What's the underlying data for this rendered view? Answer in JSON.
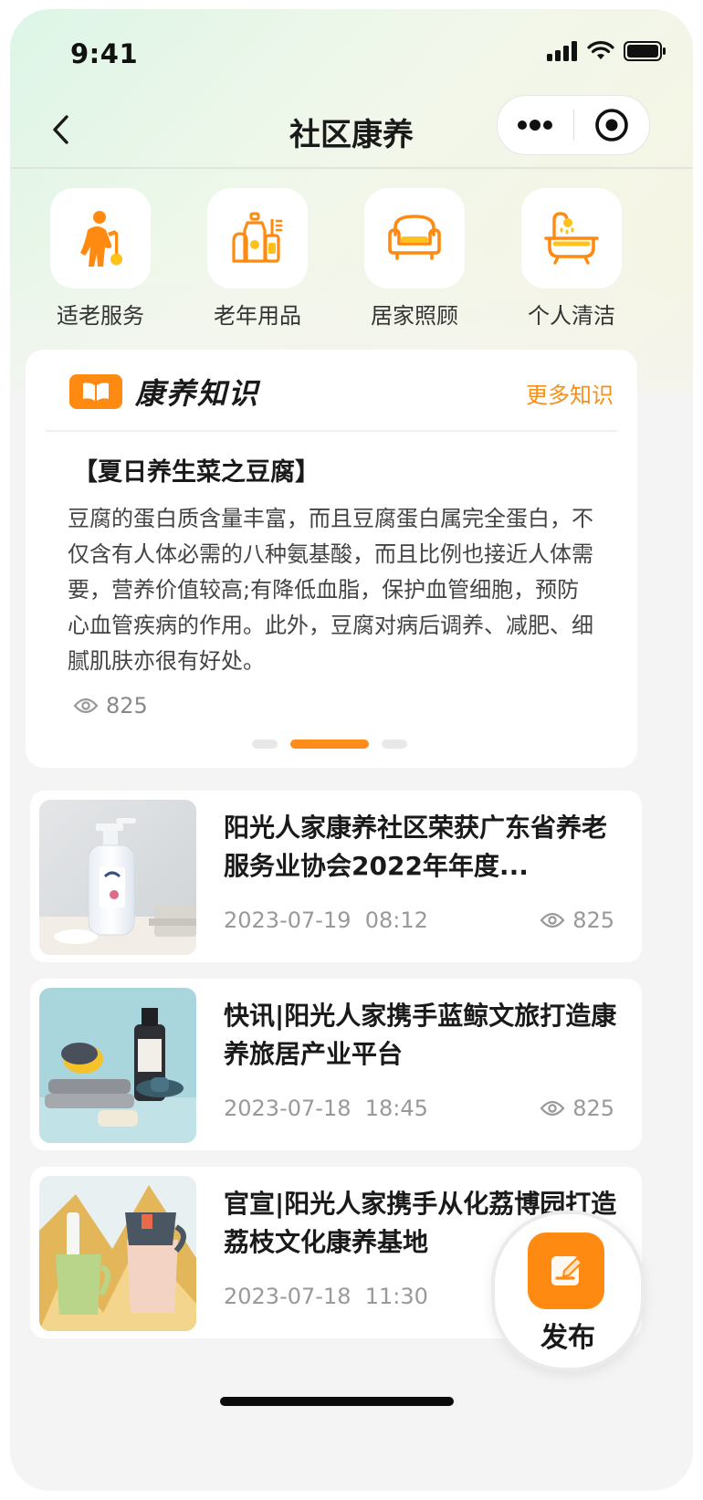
{
  "status_bar": {
    "time": "9:41"
  },
  "nav": {
    "title": "社区康养"
  },
  "categories": [
    {
      "label": "适老服务",
      "icon": "elderly-person-icon"
    },
    {
      "label": "老年用品",
      "icon": "bottles-icon"
    },
    {
      "label": "居家照顾",
      "icon": "sofa-icon"
    },
    {
      "label": "个人清洁",
      "icon": "bathtub-icon"
    }
  ],
  "knowledge": {
    "title": "康养知识",
    "more": "更多知识",
    "article_title": "【夏日养生菜之豆腐】",
    "article_body": "豆腐的蛋白质含量丰富，而且豆腐蛋白属完全蛋白，不仅含有人体必需的八种氨基酸，而且比例也接近人体需要，营养价值较高;有降低血脂，保护血管细胞，预防心血管疾病的作用。此外，豆腐对病后调养、减肥、细腻肌肤亦很有好处。",
    "views": "825",
    "carousel_active_index": 1,
    "carousel_count": 3
  },
  "news": [
    {
      "title": "阳光人家康养社区荣获广东省养老服务业协会2022年年度...",
      "date": "2023-07-19",
      "time": "08:12",
      "views": "825"
    },
    {
      "title": "快讯|阳光人家携手蓝鲸文旅打造康养旅居产业平台",
      "date": "2023-07-18",
      "time": "18:45",
      "views": "825"
    },
    {
      "title": "官宣|阳光人家携手从化荔博园打造荔枝文化康养基地",
      "date": "2023-07-18",
      "time": "11:30",
      "views": ""
    }
  ],
  "fab": {
    "label": "发布"
  },
  "colors": {
    "accent": "#ff8a12",
    "link": "#f5901c"
  }
}
